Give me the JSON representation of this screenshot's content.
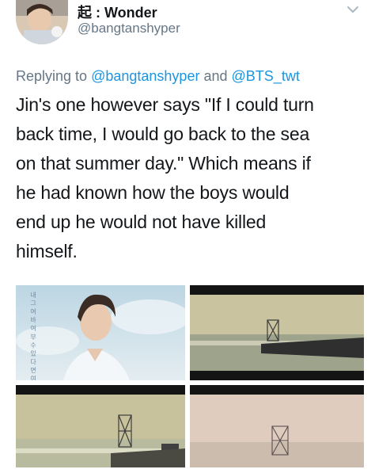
{
  "author": {
    "display_name": "起 : Wonder",
    "handle": "@bangtanshyper"
  },
  "reply_context": {
    "prefix": "Replying to",
    "mention_1": "@bangtanshyper",
    "connector": "and",
    "mention_2": "@BTS_twt"
  },
  "tweet": {
    "lines": [
      "Jin's one however says \"If I could turn",
      "back time, I would go back to the sea",
      "on that summer day.\" Which means if",
      "he had known how the boys would",
      "end up he would not have killed",
      "himself."
    ]
  },
  "media": {
    "poster_vertical_text": "내 그 여 바 여 부 수 있 다 면 여 름 날"
  },
  "icons": {
    "menu": "chevron-down-icon"
  },
  "colors": {
    "text": "#14171a",
    "muted": "#657786",
    "link": "#1b95e0"
  }
}
